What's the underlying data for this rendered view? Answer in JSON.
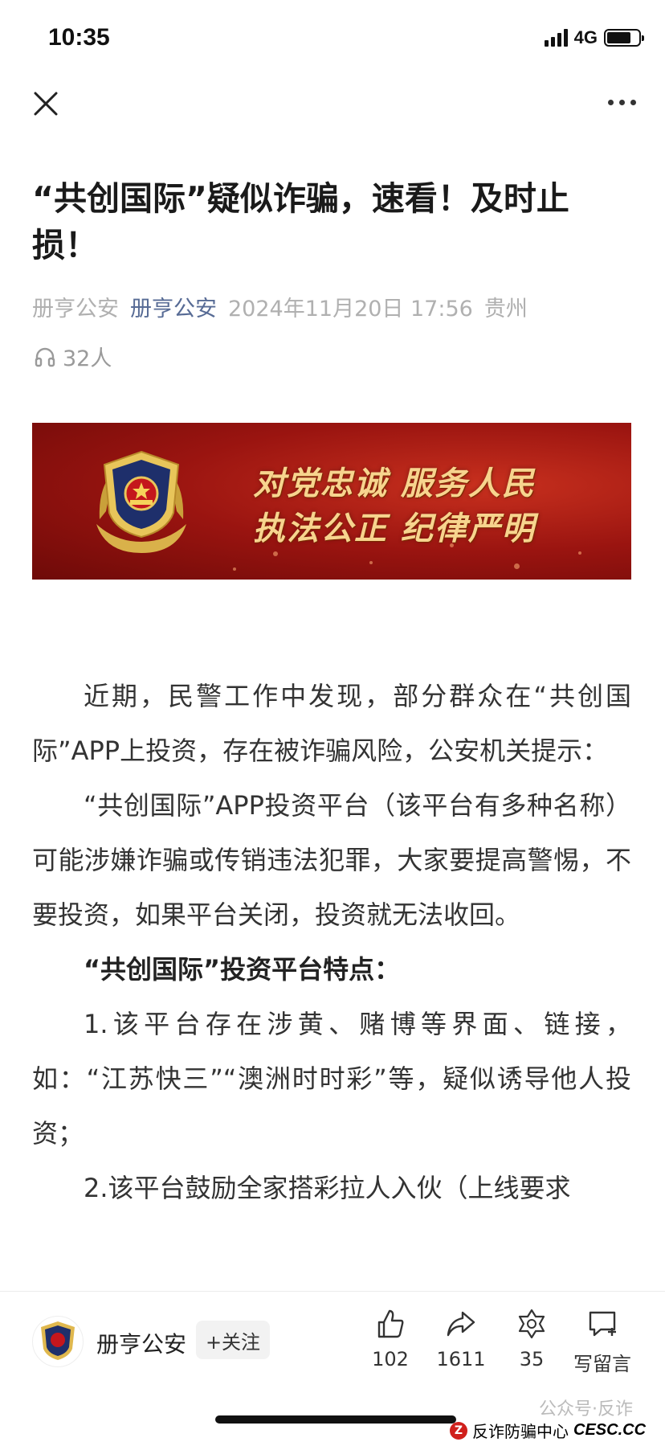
{
  "status": {
    "time": "10:35",
    "network": "4G"
  },
  "article": {
    "title": "“共创国际”疑似诈骗，速看！及时止损！",
    "meta": {
      "author": "册亨公安",
      "account": "册亨公安",
      "date": "2024年11月20日 17:56",
      "location": "贵州"
    },
    "listeners": "32人"
  },
  "banner": {
    "line1": "对党忠诚 服务人民",
    "line2": "执法公正 纪律严明"
  },
  "body": {
    "p1": "近期，民警工作中发现，部分群众在“共创国际”APP上投资，存在被诈骗风险，公安机关提示：",
    "p2": "“共创国际”APP投资平台（该平台有多种名称）可能涉嫌诈骗或传销违法犯罪，大家要提高警惕，不要投资，如果平台关闭，投资就无法收回。",
    "p3": "“共创国际”投资平台特点：",
    "p4": "1.该平台存在涉黄、赌博等界面、链接，如：“江苏快三”“澳洲时时彩”等，疑似诱导他人投资；",
    "p5": "2.该平台鼓励全家搭彩拉人入伙（上线要求"
  },
  "bottom": {
    "account_name": "册亨公安",
    "follow_label": "+关注",
    "likes": "102",
    "shares": "1611",
    "recommends": "35",
    "comment_label": "写留言",
    "watermark_text": "公众号·反诈",
    "watermark_center": "反诈防骗中心",
    "watermark_site": "CESC.CC",
    "watermark_logo": "Z"
  }
}
